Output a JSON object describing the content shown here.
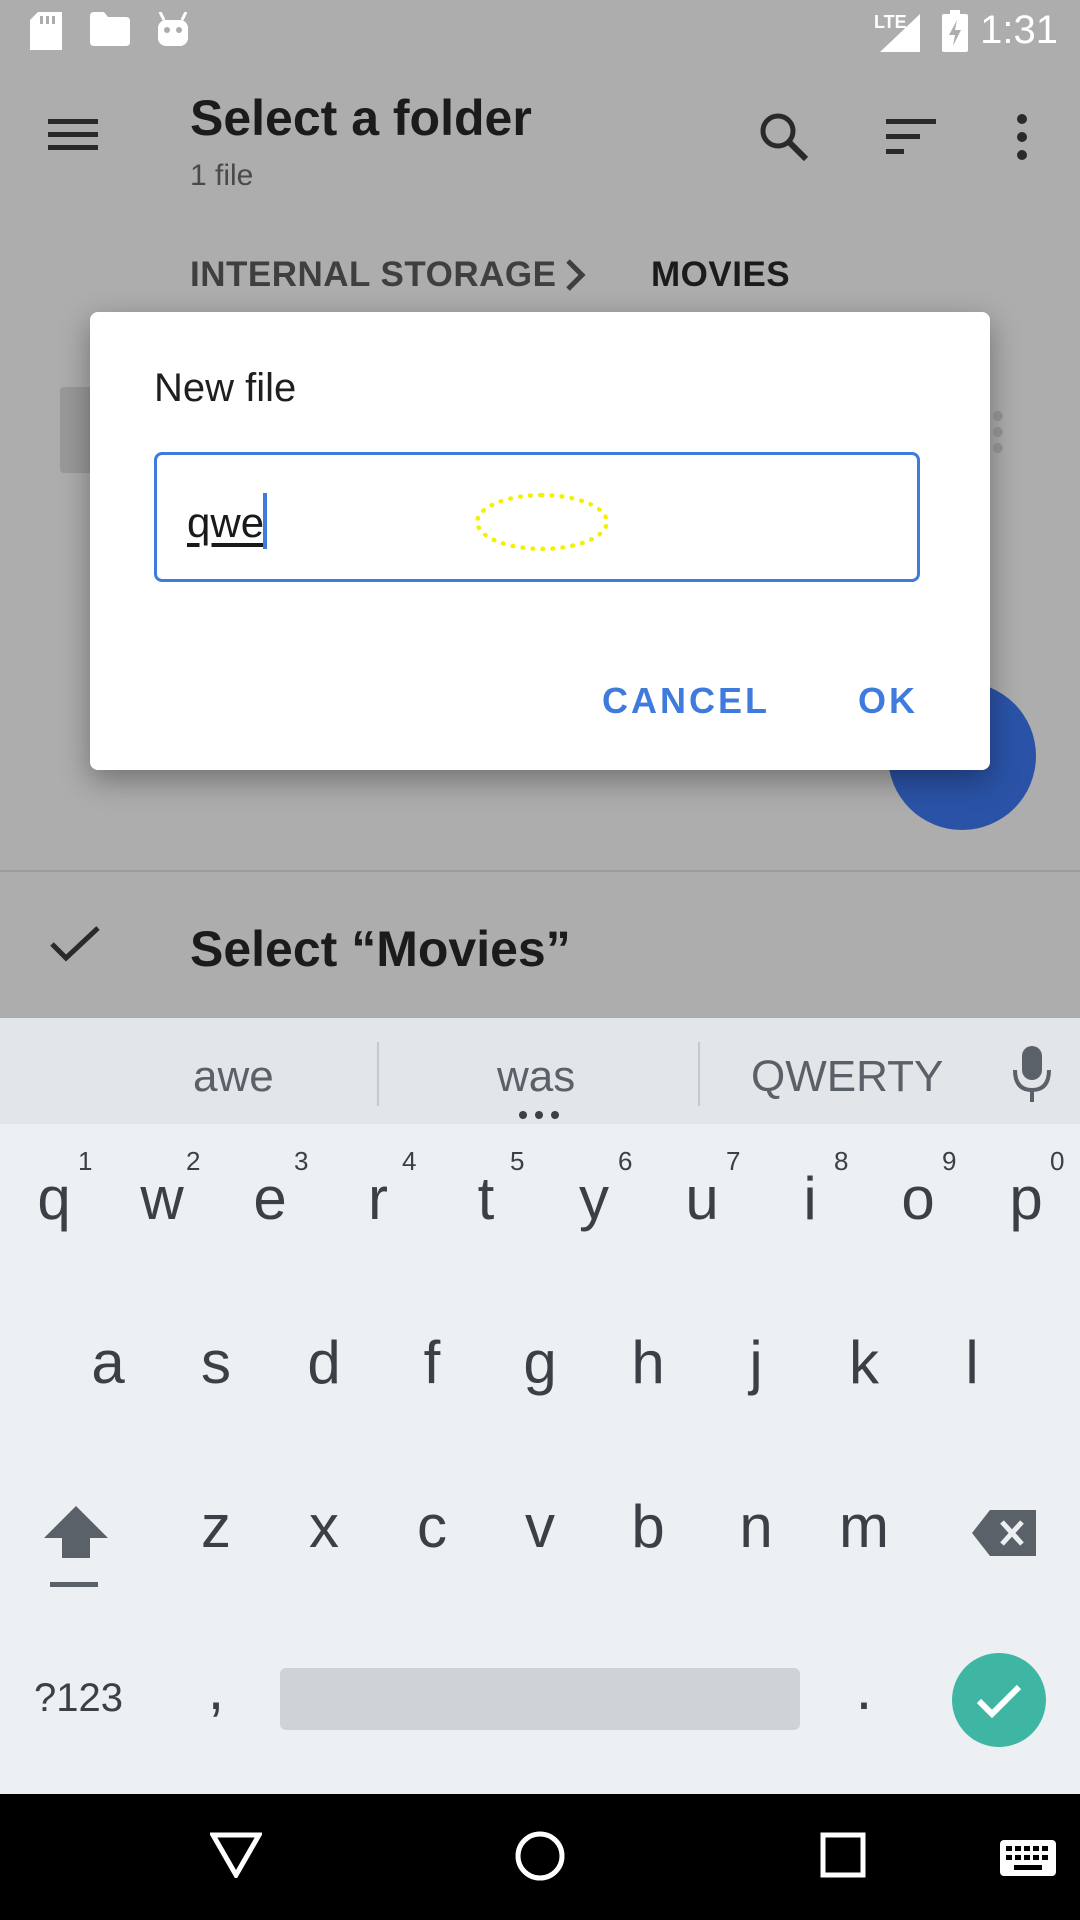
{
  "status_bar": {
    "time": "1:31",
    "network": "LTE",
    "icons": [
      "sd-card-icon",
      "folder-icon",
      "android-icon",
      "signal-icon",
      "battery-charging-icon"
    ]
  },
  "toolbar": {
    "title": "Select a folder",
    "subtitle": "1 file",
    "icons": [
      "menu-icon",
      "search-icon",
      "sort-icon",
      "more-vert-icon"
    ]
  },
  "breadcrumb": {
    "items": [
      "INTERNAL STORAGE",
      "MOVIES"
    ]
  },
  "select_bar": {
    "label": "Select “Movies”"
  },
  "dialog": {
    "title": "New file",
    "input_value": "qwe",
    "cancel_label": "CANCEL",
    "ok_label": "OK"
  },
  "keyboard": {
    "suggestions": [
      "awe",
      "was",
      "QWERTY"
    ],
    "row1": [
      "q",
      "w",
      "e",
      "r",
      "t",
      "y",
      "u",
      "i",
      "o",
      "p"
    ],
    "row1_hints": [
      "1",
      "2",
      "3",
      "4",
      "5",
      "6",
      "7",
      "8",
      "9",
      "0"
    ],
    "row2": [
      "a",
      "s",
      "d",
      "f",
      "g",
      "h",
      "j",
      "k",
      "l"
    ],
    "row3": [
      "z",
      "x",
      "c",
      "v",
      "b",
      "n",
      "m"
    ],
    "symbols_label": "?123",
    "comma": ",",
    "period": "."
  },
  "colors": {
    "accent": "#3f7bdc",
    "fab": "#2a53a7",
    "enter": "#3fb6a4",
    "scrim": "#adadad"
  }
}
